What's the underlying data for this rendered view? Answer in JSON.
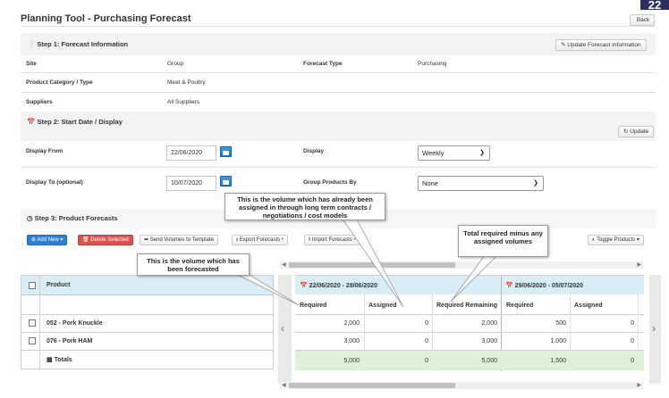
{
  "header": {
    "title": "Planning Tool - Purchasing Forecast",
    "back_label": "Back",
    "logo_text": "22"
  },
  "step1": {
    "title": "Step 1: Forecast Information",
    "update_button": "Update Forecast Information",
    "rows": [
      {
        "label": "Site",
        "value": "Group",
        "label2": "Forecast Type",
        "value2": "Purchasing"
      },
      {
        "label": "Product Category / Type",
        "value": "Meat & Poultry"
      },
      {
        "label": "Suppliers",
        "value": "All Suppliers"
      }
    ]
  },
  "step2": {
    "title": "Step 2: Start Date / Display",
    "update_button": "Update",
    "display_from_label": "Display From",
    "display_from_value": "22/06/2020",
    "display_label": "Display",
    "display_value": "Weekly",
    "display_to_label": "Display To (optional)",
    "display_to_value": "10/07/2020",
    "group_by_label": "Group Products By",
    "group_by_value": "None"
  },
  "step3": {
    "title": "Step 3: Product Forecasts",
    "toolbar": {
      "add_new": "Add New",
      "delete_selected": "Delete Selected",
      "send_volumes": "Send Volumes to Template",
      "export": "Export Forecasts",
      "import": "Import Forecasts",
      "toggle_products": "Toggle Products"
    }
  },
  "table": {
    "product_header": "Product",
    "products": [
      {
        "name": "052 - Pork Knuckle"
      },
      {
        "name": "076 - Pork HAM"
      }
    ],
    "totals_label": "Totals",
    "periods": [
      {
        "label": "22/06/2020 - 28/06/2020"
      },
      {
        "label": "29/06/2020 - 05/07/2020"
      }
    ],
    "columns": [
      "Required",
      "Assigned",
      "Required Remaining",
      "Required",
      "Assigned"
    ],
    "rows": [
      [
        "2,000",
        "0",
        "2,000",
        "500",
        "0"
      ],
      [
        "3,000",
        "0",
        "3,000",
        "1,000",
        "0"
      ]
    ],
    "totals": [
      "5,000",
      "0",
      "5,000",
      "1,500",
      "0"
    ]
  },
  "callouts": {
    "assigned": "This is the volume which has already been assigned in through long term contracts / negotiations / cost models",
    "forecasted": "This is the volume which has been forecasted",
    "remaining": "Total required minus any assigned volumes"
  },
  "colors": {
    "period_header": "#d9edf7",
    "totals_row": "#dff0d8",
    "add_new": "#2d7fd3",
    "delete": "#d9534f"
  }
}
